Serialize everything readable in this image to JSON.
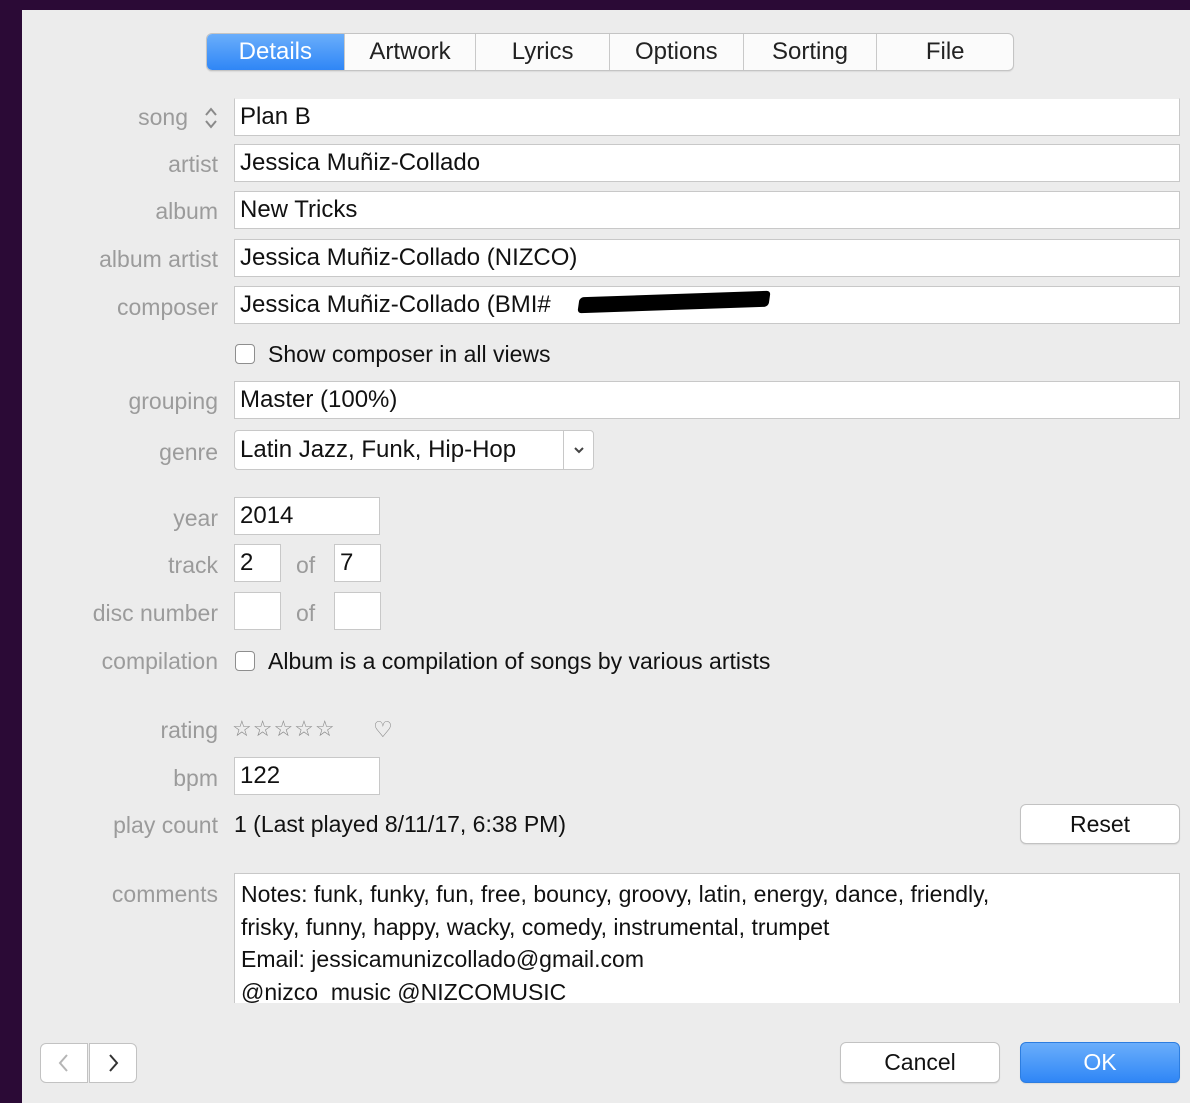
{
  "tabs": [
    "Details",
    "Artwork",
    "Lyrics",
    "Options",
    "Sorting",
    "File"
  ],
  "labels": {
    "song": "song",
    "artist": "artist",
    "album": "album",
    "album_artist": "album artist",
    "composer": "composer",
    "grouping": "grouping",
    "genre": "genre",
    "year": "year",
    "track": "track",
    "disc_number": "disc number",
    "compilation": "compilation",
    "rating": "rating",
    "bpm": "bpm",
    "play_count": "play count",
    "comments": "comments",
    "of": "of"
  },
  "fields": {
    "song": "Plan B",
    "artist": "Jessica Muñiz-Collado",
    "album": "New Tricks",
    "album_artist": "Jessica Muñiz-Collado (NIZCO)",
    "composer": "Jessica Muñiz-Collado (BMI#",
    "grouping": "Master (100%)",
    "genre": "Latin Jazz, Funk, Hip-Hop",
    "year": "2014",
    "track": "2",
    "track_of": "7",
    "disc": "",
    "disc_of": "",
    "bpm": "122",
    "play_count": "1 (Last played 8/11/17, 6:38 PM)"
  },
  "checkboxes": {
    "show_composer": {
      "label": "Show composer in all views",
      "checked": false
    },
    "compilation": {
      "label": "Album is a compilation of songs by various artists",
      "checked": false
    }
  },
  "rating": {
    "stars": "☆☆☆☆☆",
    "heart": "♡",
    "value": 0,
    "max": 5
  },
  "comments": [
    "Notes: funk, funky, fun, free, bouncy, groovy, latin, energy, dance, friendly,",
    "frisky, funny, happy, wacky, comedy, instrumental, trumpet",
    "Email: jessicamunizcollado@gmail.com",
    "@nizco_music @NIZCOMUSIC"
  ],
  "buttons": {
    "reset": "Reset",
    "cancel": "Cancel",
    "ok": "OK"
  },
  "icons": {
    "song_stepper": "up-down-chevron-icon",
    "genre_dropdown": "chevron-down-icon",
    "prev": "chevron-left-icon",
    "next": "chevron-right-icon"
  }
}
